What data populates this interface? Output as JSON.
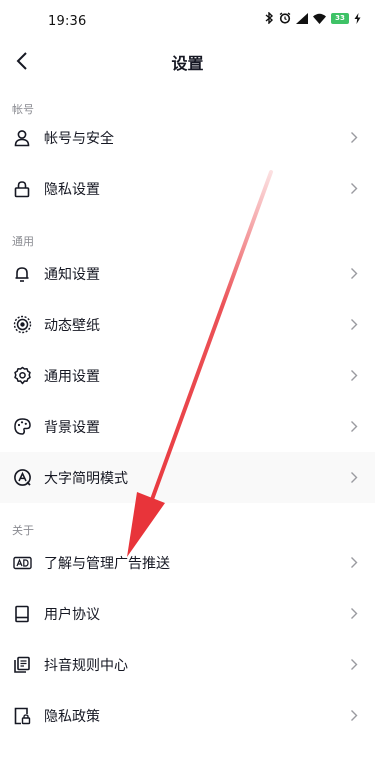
{
  "status_bar": {
    "time": "19:36",
    "battery": "33"
  },
  "nav": {
    "title": "设置"
  },
  "sections": {
    "account": {
      "header": "帐号",
      "items": [
        {
          "label": "帐号与安全",
          "icon": "person-icon"
        },
        {
          "label": "隐私设置",
          "icon": "lock-icon"
        }
      ]
    },
    "general": {
      "header": "通用",
      "items": [
        {
          "label": "通知设置",
          "icon": "bell-icon"
        },
        {
          "label": "动态壁纸",
          "icon": "target-icon"
        },
        {
          "label": "通用设置",
          "icon": "gear-icon"
        },
        {
          "label": "背景设置",
          "icon": "palette-icon"
        },
        {
          "label": "大字简明模式",
          "icon": "font-size-icon"
        }
      ]
    },
    "about": {
      "header": "关于",
      "items": [
        {
          "label": "了解与管理广告推送",
          "icon": "ad-icon"
        },
        {
          "label": "用户协议",
          "icon": "book-icon"
        },
        {
          "label": "抖音规则中心",
          "icon": "rules-icon"
        },
        {
          "label": "隐私政策",
          "icon": "privacy-policy-icon"
        }
      ]
    }
  },
  "colors": {
    "annotation_arrow": "#e8343a",
    "text": "#161823",
    "muted": "#8a8b91"
  }
}
